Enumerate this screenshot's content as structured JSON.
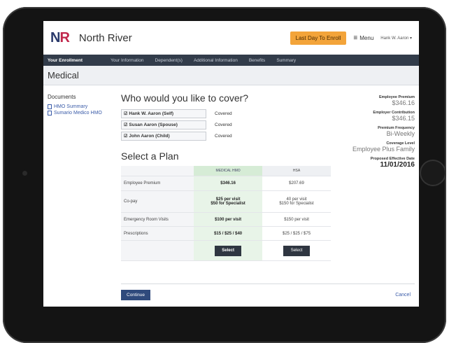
{
  "header": {
    "logo_n": "N",
    "logo_r": "R",
    "brand": "North River",
    "cta": "Last Day To Enroll",
    "menu_label": "Menu",
    "user": "Hank W. Aaron"
  },
  "nav": {
    "active": "Your Enrollment",
    "items": [
      "Your Information",
      "Dependent(s)",
      "Additional Information",
      "Benefits",
      "Summary"
    ]
  },
  "section_title": "Medical",
  "documents": {
    "title": "Documents",
    "items": [
      "HMO Summary",
      "Sumario Medico HMO"
    ]
  },
  "cover": {
    "question": "Who would you like to cover?",
    "members": [
      {
        "name": "Hank W. Aaron (Self)",
        "status": "Covered"
      },
      {
        "name": "Susan Aaron (Spouse)",
        "status": "Covered"
      },
      {
        "name": "John Aaron (Child)",
        "status": "Covered"
      }
    ]
  },
  "plan": {
    "title": "Select a Plan",
    "columns": [
      "MEDICAL HMO",
      "HSA"
    ],
    "rows": [
      {
        "label": "Employee Premium",
        "hmo": "$346.16",
        "hsa": "$207.69"
      },
      {
        "label": "Co-pay",
        "hmo": "$25 per visit\n$50 for Specialist",
        "hsa": "40 per visit\n$150 for Specialist"
      },
      {
        "label": "Emergency Room Visits",
        "hmo": "$100 per visit",
        "hsa": "$150 per visit"
      },
      {
        "label": "Prescriptions",
        "hmo": "$15 / $25 / $40",
        "hsa": "$25 / $25 / $75"
      }
    ],
    "select_label": "Select"
  },
  "summary": [
    {
      "label": "Employee Premium",
      "value": "$346.16"
    },
    {
      "label": "Employer Contribution",
      "value": "$346.15"
    },
    {
      "label": "Premium Frequency",
      "value": "Bi-Weekly"
    },
    {
      "label": "Coverage Level",
      "value": "Employee Plus Family"
    },
    {
      "label": "Proposed Effective Date",
      "value": "11/01/2016"
    }
  ],
  "footer": {
    "continue": "Continue",
    "cancel": "Cancel"
  }
}
